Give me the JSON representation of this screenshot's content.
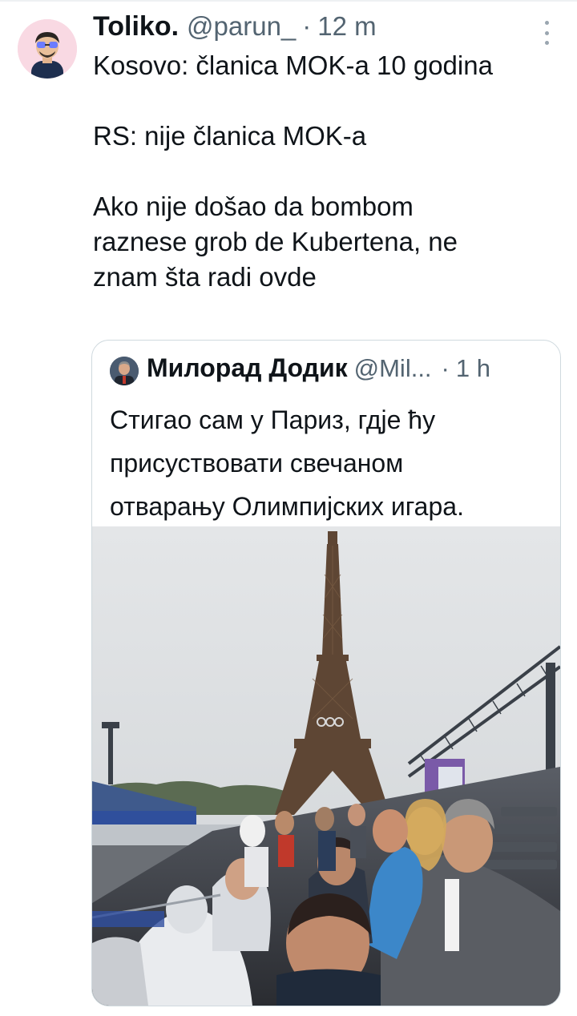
{
  "tweet": {
    "display_name": "Toliko.",
    "handle": "@parun_",
    "separator": "·",
    "time": "12 m",
    "text_lines": [
      "Kosovo: članica MOK-a 10 godina",
      "RS: nije članica MOK-a",
      "Ako nije došao da bombom",
      "raznese grob de Kubertena, ne",
      "znam šta radi ovde"
    ],
    "avatar_bg": "#f9d9e3"
  },
  "quoted": {
    "display_name": "Милорад Додик",
    "handle": "@Mil...",
    "separator": "·",
    "time": "1 h",
    "text_lines": [
      "Стигао сам у Париз, гдје ћу",
      "присуствовати свечаном",
      "отварању Олимпијских игара."
    ],
    "border_color": "#cfd9de"
  },
  "colors": {
    "text": "#0f1419",
    "secondary": "#536471"
  },
  "icons": {
    "more": "more-options-icon"
  },
  "media": {
    "description_icon": "photo-eiffel-tower-stadium"
  }
}
